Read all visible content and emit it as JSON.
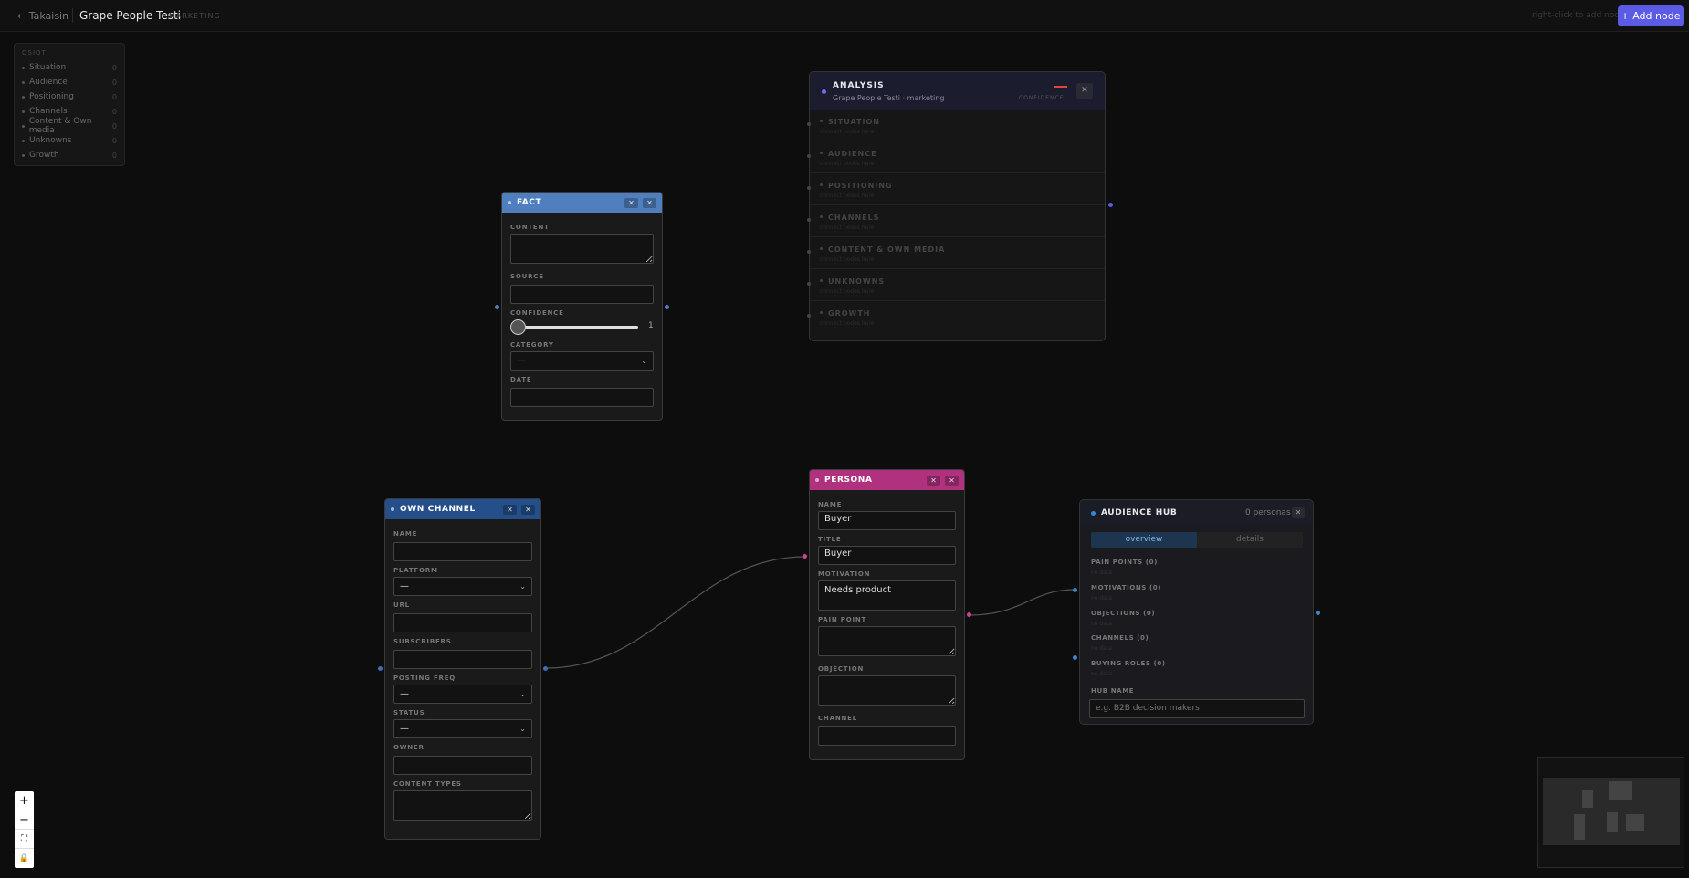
{
  "topbar": {
    "back": "← Takaisin",
    "project": "Grape People Testi",
    "tag": "MARKETING",
    "hint": "right-click to add node",
    "add_button": "+ Add node"
  },
  "outline": {
    "title": "OSIOT",
    "items": [
      {
        "label": "Situation",
        "count": "0"
      },
      {
        "label": "Audience",
        "count": "0"
      },
      {
        "label": "Positioning",
        "count": "0"
      },
      {
        "label": "Channels",
        "count": "0"
      },
      {
        "label": "Content & Own media",
        "count": "0"
      },
      {
        "label": "Unknowns",
        "count": "0"
      },
      {
        "label": "Growth",
        "count": "0"
      }
    ]
  },
  "fact": {
    "title": "FACT",
    "content_label": "CONTENT",
    "source_label": "SOURCE",
    "confidence_label": "CONFIDENCE",
    "confidence_value": "1",
    "category_label": "CATEGORY",
    "category_value": "—",
    "date_label": "DATE"
  },
  "analysis": {
    "title": "ANALYSIS",
    "subtitle": "Grape People Testi · marketing",
    "confidence_label": "CONFIDENCE",
    "sections": [
      {
        "title": "SITUATION",
        "placeholder": "connect nodes here"
      },
      {
        "title": "AUDIENCE",
        "placeholder": "connect nodes here"
      },
      {
        "title": "POSITIONING",
        "placeholder": "connect nodes here"
      },
      {
        "title": "CHANNELS",
        "placeholder": "connect nodes here"
      },
      {
        "title": "CONTENT & OWN MEDIA",
        "placeholder": "connect nodes here"
      },
      {
        "title": "UNKNOWNS",
        "placeholder": "connect nodes here"
      },
      {
        "title": "GROWTH",
        "placeholder": "connect nodes here"
      }
    ]
  },
  "persona": {
    "title": "PERSONA",
    "name_label": "NAME",
    "name_value": "Buyer",
    "title_label": "TITLE",
    "title_value": "Buyer",
    "motivation_label": "MOTIVATION",
    "motivation_value": "Needs product",
    "painpoint_label": "PAIN POINT",
    "objection_label": "OBJECTION",
    "channel_label": "CHANNEL"
  },
  "own_channel": {
    "title": "OWN CHANNEL",
    "name_label": "NAME",
    "platform_label": "PLATFORM",
    "platform_value": "—",
    "url_label": "URL",
    "subscribers_label": "SUBSCRIBERS",
    "posting_label": "POSTING FREQ",
    "posting_value": "—",
    "status_label": "STATUS",
    "status_value": "—",
    "owner_label": "OWNER",
    "content_types_label": "CONTENT TYPES"
  },
  "hub": {
    "title": "AUDIENCE HUB",
    "count": "0 personas",
    "tab_overview": "overview",
    "tab_details": "details",
    "pain_points": "PAIN POINTS (0)",
    "motivations": "MOTIVATIONS (0)",
    "objections": "OBJECTIONS (0)",
    "channels": "CHANNELS (0)",
    "buying_roles": "BUYING ROLES (0)",
    "none": "no data",
    "hub_name_label": "HUB NAME",
    "hub_name_placeholder": "e.g. B2B decision makers"
  },
  "controls": {
    "zoom_in": "+",
    "zoom_out": "−",
    "fit": "⛶",
    "lock": "🔒"
  },
  "colors": {
    "fact": "#4f7fbf",
    "own_channel": "#254f8a",
    "persona": "#b0327f",
    "accent": "#5b5be6"
  }
}
